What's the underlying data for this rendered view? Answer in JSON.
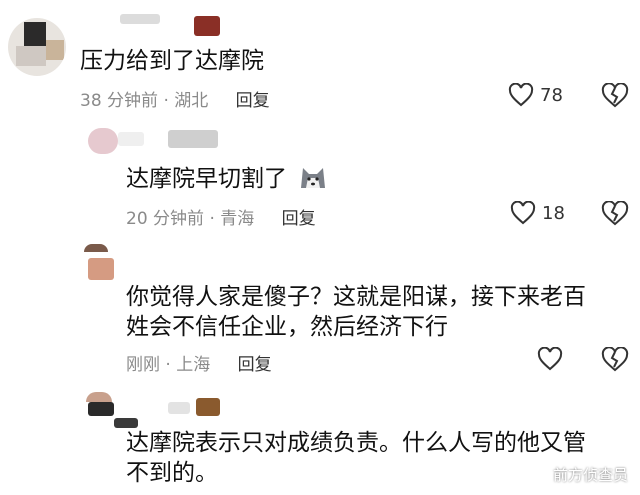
{
  "comments": [
    {
      "text": "压力给到了达摩院",
      "time": "38 分钟前",
      "location": "湖北",
      "reply_label": "回复",
      "likes": "78",
      "icons": [
        "heart-icon",
        "broken-heart-icon"
      ]
    },
    {
      "text": "达摩院早切割了",
      "emoji": "husky-emoji",
      "time": "20 分钟前",
      "location": "青海",
      "reply_label": "回复",
      "likes": "18",
      "icons": [
        "heart-icon",
        "broken-heart-icon"
      ]
    },
    {
      "text_line1": "你觉得人家是傻子？这就是阳谋，接下来老百",
      "text_line2": "姓会不信任企业，然后经济下行",
      "time": "刚刚",
      "location": "上海",
      "reply_label": "回复",
      "likes": "",
      "icons": [
        "heart-icon",
        "broken-heart-icon"
      ]
    },
    {
      "text_line1": "达摩院表示只对成绩负责。什么人写的他又管",
      "text_line2": "不到的。"
    }
  ],
  "separator": "·",
  "watermark": {
    "text": "前方侦查员",
    "icon": "weibo-eye-icon"
  }
}
